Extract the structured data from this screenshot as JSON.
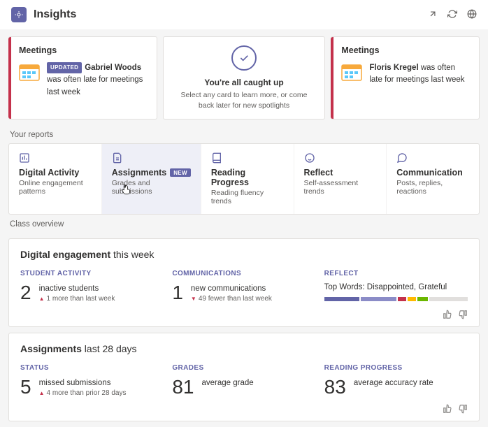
{
  "header": {
    "title": "Insights"
  },
  "spotlight": {
    "card1": {
      "title": "Meetings",
      "badge": "UPDATED",
      "name": "Gabriel Woods",
      "rest": " was often late for meetings last week"
    },
    "caught": {
      "title": "You're all caught up",
      "sub": "Select any card to learn more, or come back later for new spotlights"
    },
    "card2": {
      "title": "Meetings",
      "name": "Floris Kregel",
      "rest": " was often late for meetings last week"
    }
  },
  "labels": {
    "your_reports": "Your reports",
    "class_overview": "Class overview"
  },
  "tabs": {
    "t0": {
      "label": "Digital Activity",
      "sub": "Online engagement patterns"
    },
    "t1": {
      "label": "Assignments",
      "badge": "NEW",
      "sub": "Grades and submissions"
    },
    "t2": {
      "label": "Reading Progress",
      "sub": "Reading fluency trends"
    },
    "t3": {
      "label": "Reflect",
      "sub": "Self-assessment trends"
    },
    "t4": {
      "label": "Communication",
      "sub": "Posts, replies, reactions"
    }
  },
  "engagement": {
    "title_b": "Digital engagement",
    "title_r": " this week",
    "m0": {
      "label": "STUDENT ACTIVITY",
      "num": "2",
      "main": "inactive students",
      "sub": "1 more than last week"
    },
    "m1": {
      "label": "COMMUNICATIONS",
      "num": "1",
      "main": "new communications",
      "sub": "49 fewer than last week"
    },
    "m2": {
      "label": "REFLECT",
      "text": "Top Words: Disappointed, Grateful"
    }
  },
  "assignments": {
    "title_b": "Assignments",
    "title_r": " last 28 days",
    "m0": {
      "label": "STATUS",
      "num": "5",
      "main": "missed submissions",
      "sub": "4 more than prior 28 days"
    },
    "m1": {
      "label": "GRADES",
      "num": "81",
      "main": "average grade"
    },
    "m2": {
      "label": "READING PROGRESS",
      "num": "83",
      "main": "average accuracy rate"
    }
  },
  "reflect_bars": [
    {
      "w": "26%",
      "c": "#6264a7"
    },
    {
      "w": "26%",
      "c": "#8b8cc7"
    },
    {
      "w": "6%",
      "c": "#c4314b"
    },
    {
      "w": "6%",
      "c": "#ffb900"
    },
    {
      "w": "8%",
      "c": "#6bb700"
    },
    {
      "w": "28%",
      "c": "#e1dfdd"
    }
  ]
}
